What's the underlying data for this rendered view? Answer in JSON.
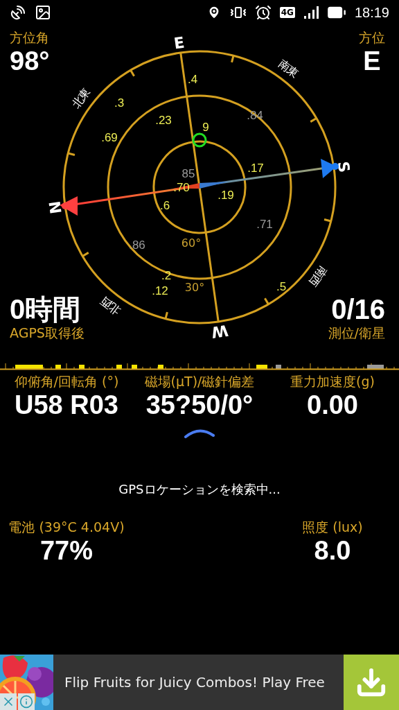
{
  "status_bar": {
    "network": "4G",
    "time": "18:19"
  },
  "azimuth": {
    "label": "方位角",
    "value": "98°"
  },
  "heading": {
    "label": "方位",
    "value": "E"
  },
  "compass": {
    "directions": [
      {
        "label": "N"
      },
      {
        "label": "北東"
      },
      {
        "label": "E"
      },
      {
        "label": "南東"
      },
      {
        "label": "S"
      },
      {
        "label": "南西"
      },
      {
        "label": "W"
      },
      {
        "label": "北西"
      }
    ],
    "ring_labels": [
      "60°",
      "30°"
    ],
    "satellites": [
      {
        "label": ".4",
        "color": "#eeee55"
      },
      {
        "label": ".3",
        "color": "#eeee55"
      },
      {
        "label": ".23",
        "color": "#eeee55"
      },
      {
        "label": ".84",
        "color": "#9a9a9a"
      },
      {
        "label": ".69",
        "color": "#eeee55"
      },
      {
        "label": "9",
        "color": "#eeee55"
      },
      {
        "label": ".17",
        "color": "#eeee55"
      },
      {
        "label": "85",
        "color": "#9a9a9a"
      },
      {
        "label": ".70",
        "color": "#eeee55"
      },
      {
        "label": ".19",
        "color": "#eeee55"
      },
      {
        "label": ".6",
        "color": "#eeee55"
      },
      {
        "label": ".71",
        "color": "#9a9a9a"
      },
      {
        "label": ".86",
        "color": "#9a9a9a"
      },
      {
        "label": ".2",
        "color": "#eeee55"
      },
      {
        "label": ".12",
        "color": "#eeee55"
      },
      {
        "label": ".5",
        "color": "#eeee55"
      }
    ]
  },
  "fix_time": {
    "value": "0時間",
    "label": "AGPS取得後"
  },
  "satellite_count": {
    "value": "0/16",
    "label": "測位/衛星"
  },
  "sensors": [
    {
      "label": "仰俯角/回転角 (°)",
      "value": "U58 R03"
    },
    {
      "label": "磁場(μT)/磁針偏差",
      "value": "35?50/0°"
    },
    {
      "label": "重力加速度(g)",
      "value": "0.00"
    }
  ],
  "status_message": "GPSロケーションを検索中...",
  "battery": {
    "label": "電池 (39°C 4.04V)",
    "value": "77%"
  },
  "illuminance": {
    "label": "照度 (lux)",
    "value": "8.0"
  },
  "ad": {
    "text": "Flip Fruits for Juicy Combos! Play Free"
  }
}
